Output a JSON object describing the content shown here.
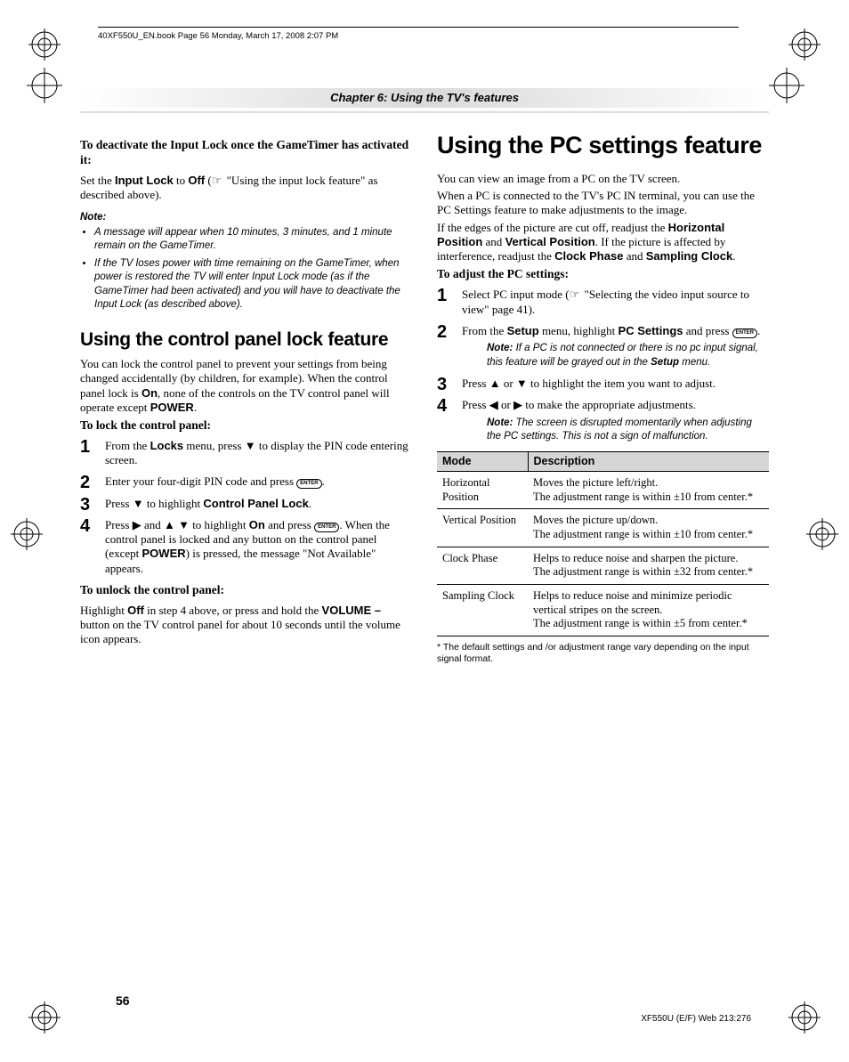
{
  "running_head": "40XF550U_EN.book  Page 56  Monday, March 17, 2008  2:07 PM",
  "chapter_title": "Chapter 6: Using the TV's features",
  "page_number": "56",
  "footer_code": "XF550U (E/F) Web 213:276",
  "enter_label": "ENTER",
  "left": {
    "intro_heading": "To deactivate the Input Lock once the GameTimer has activated it:",
    "intro_pre": "Set the ",
    "intro_b1": "Input Lock",
    "intro_mid1": " to ",
    "intro_b2": "Off",
    "intro_mid2": " (",
    "intro_ref": " \"Using the input lock feature\" as described above).",
    "note_label": "Note:",
    "note1": "A message will appear when 10 minutes, 3 minutes, and 1 minute remain on the GameTimer.",
    "note2": "If the TV loses power with time remaining on the GameTimer, when power is restored the TV will enter Input Lock mode (as if the GameTimer had been activated) and you will have to deactivate the Input Lock (as described above).",
    "h2": "Using the control panel lock feature",
    "lock_intro": "You can lock the control panel to prevent your settings from being changed accidentally (by children, for example). When the control panel lock is ",
    "lock_on": "On",
    "lock_intro2": ", none of the controls on the TV control panel will operate except ",
    "lock_power": "POWER",
    "lock_intro3": ".",
    "tolock": "To lock the control panel:",
    "s1a": "From the ",
    "s1b": "Locks",
    "s1c": " menu, press ▼ to display the PIN code entering screen.",
    "s2a": "Enter your four-digit PIN code and press ",
    "s2b": ".",
    "s3a": "Press ▼ to highlight ",
    "s3b": "Control Panel Lock",
    "s3c": ".",
    "s4a": "Press ▶ and ▲ ▼ to highlight ",
    "s4b": "On",
    "s4c": " and press ",
    "s4d": ". When the control panel is locked and any button on the control panel (except ",
    "s4e": "POWER",
    "s4f": ") is pressed, the message \"Not Available\" appears.",
    "tounlock": "To unlock the control panel:",
    "unlock_a": "Highlight ",
    "unlock_b": "Off",
    "unlock_c": " in step 4 above, or press and hold the ",
    "unlock_d": "VOLUME –",
    "unlock_e": " button on the TV control panel for about 10 seconds until the volume icon appears."
  },
  "right": {
    "h1": "Using the PC settings feature",
    "p1": "You can view an image from a PC on the TV screen.",
    "p2": "When a PC is connected to the TV's PC IN terminal, you can use the PC Settings feature to make adjustments to the image.",
    "p3a": "If the edges of the picture are cut off, readjust the ",
    "p3b": "Horizontal Position",
    "p3c": " and ",
    "p3d": "Vertical Position",
    "p3e": ". If the picture is affected by interference, readjust the ",
    "p3f": "Clock Phase",
    "p3g": " and ",
    "p3h": "Sampling Clock",
    "p3i": ".",
    "adjust_heading": "To adjust the PC settings:",
    "s1a": "Select PC input mode (",
    "s1b": " \"Selecting the video input source to view\" page 41).",
    "s2a": "From the ",
    "s2b": "Setup",
    "s2c": " menu, highlight ",
    "s2d": "PC Settings",
    "s2e": " and press ",
    "s2f": ".",
    "note2a": "If a PC is not connected or there is no pc input signal, this feature will be grayed out in the ",
    "note2b": "Setup",
    "note2c": " menu.",
    "s3": "Press ▲ or ▼ to highlight the item you want to adjust.",
    "s4": "Press ◀ or ▶ to make the appropriate adjustments.",
    "note4": "The screen is disrupted momentarily when adjusting the PC settings. This is not a sign of malfunction.",
    "table": {
      "h1": "Mode",
      "h2": "Description",
      "r1m": "Horizontal Position",
      "r1d": "Moves the picture left/right.\nThe adjustment range is within ±10 from center.*",
      "r2m": "Vertical Position",
      "r2d": "Moves the picture up/down.\nThe adjustment range is within ±10 from center.*",
      "r3m": "Clock Phase",
      "r3d": "Helps to reduce noise and sharpen the picture.\nThe adjustment range is within ±32 from center.*",
      "r4m": "Sampling Clock",
      "r4d": "Helps to reduce noise and minimize periodic vertical stripes on the screen.\nThe adjustment range is within ±5 from center.*"
    },
    "table_foot": "*  The default settings and /or adjustment range vary depending on the input signal format."
  }
}
